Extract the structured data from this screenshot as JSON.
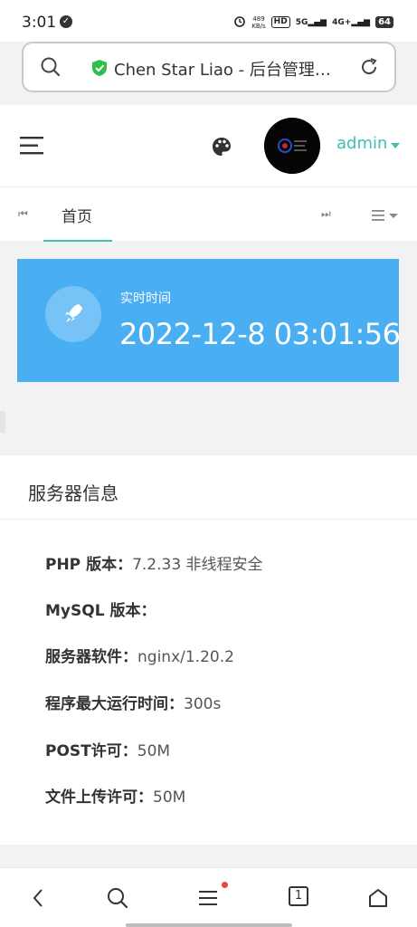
{
  "status_bar": {
    "time": "3:01",
    "net_speed_value": "489",
    "net_speed_unit": "KB/s",
    "hd_label": "HD",
    "network_label": "5G",
    "network2_label": "4G+",
    "battery": "64"
  },
  "browser": {
    "url_title": "Chen Star Liao - 后台管理…"
  },
  "header": {
    "user": "admin"
  },
  "tabs": {
    "home_label": "首页",
    "prev_glyph": "⏮",
    "next_glyph": "⏭"
  },
  "realtime": {
    "label": "实时时间",
    "value": "2022-12-8 03:01:56"
  },
  "server_info": {
    "title": "服务器信息",
    "rows": [
      {
        "label": "PHP 版本：",
        "value": "7.2.33 非线程安全"
      },
      {
        "label": "MySQL 版本：",
        "value": ""
      },
      {
        "label": "服务器软件：",
        "value": "nginx/1.20.2"
      },
      {
        "label": "程序最大运行时间：",
        "value": "300s"
      },
      {
        "label": "POST许可：",
        "value": "50M"
      },
      {
        "label": "文件上传许可：",
        "value": "50M"
      }
    ]
  },
  "bottom_nav": {
    "tab_count": "1"
  },
  "colors": {
    "accent": "#40c0b0",
    "card_blue": "#4aaef3"
  }
}
